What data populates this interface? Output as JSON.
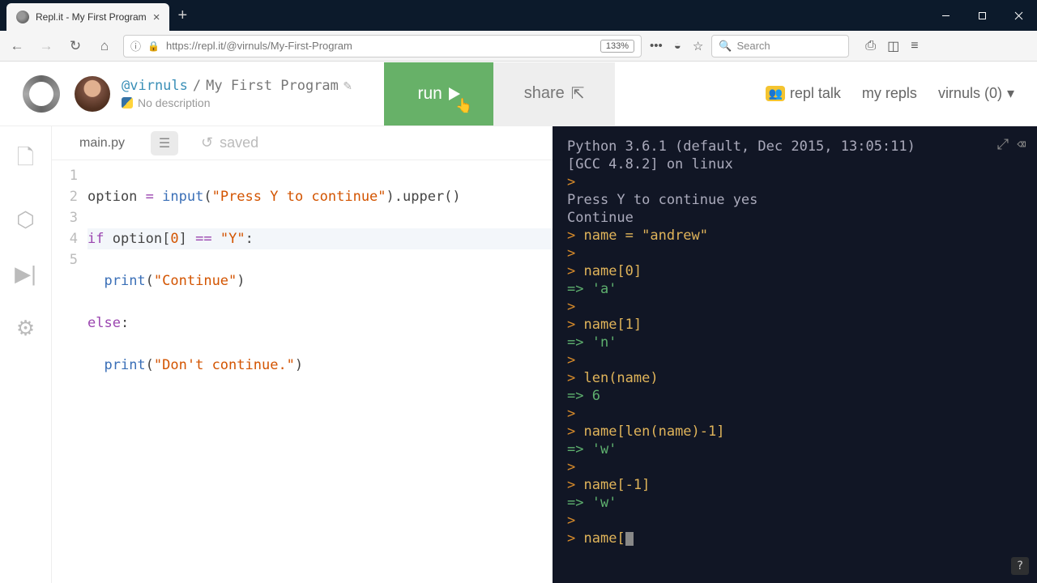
{
  "browser": {
    "tab_title": "Repl.it - My First Program",
    "url": "https://repl.it/@virnuls/My-First-Program",
    "zoom": "133%",
    "search_placeholder": "Search"
  },
  "header": {
    "user": "@virnuls",
    "separator": "/",
    "project": "My First Program",
    "description": "No description",
    "run_label": "run",
    "share_label": "share",
    "repl_talk": "repl talk",
    "my_repls": "my repls",
    "user_menu": "virnuls (0)"
  },
  "editor": {
    "filename": "main.py",
    "saved_label": "saved",
    "lines": [
      {
        "n": 1,
        "text_raw": "option = input(\"Press Y to continue\").upper()"
      },
      {
        "n": 2,
        "text_raw": "if option[0] == \"Y\":"
      },
      {
        "n": 3,
        "text_raw": "  print(\"Continue\")"
      },
      {
        "n": 4,
        "text_raw": "else:"
      },
      {
        "n": 5,
        "text_raw": "  print(\"Don't continue.\")"
      }
    ]
  },
  "terminal": {
    "info1": "Python 3.6.1 (default, Dec 2015, 13:05:11)",
    "info2": "[GCC 4.8.2] on linux",
    "io": "Press Y to continue yes",
    "out1": "Continue",
    "entries": [
      {
        "in": "name = \"andrew\"",
        "out": null
      },
      {
        "in": "",
        "out": null
      },
      {
        "in": "name[0]",
        "out": null
      },
      {
        "in": "",
        "out": "'a'"
      },
      {
        "in": "name[1]",
        "out": null
      },
      {
        "in": "",
        "out": "'n'"
      },
      {
        "in": "len(name)",
        "out": null
      },
      {
        "in": "",
        "out": "6"
      },
      {
        "in": "name[len(name)-1]",
        "out": null
      },
      {
        "in": "",
        "out": "'w'"
      },
      {
        "in": "name[-1]",
        "out": null
      },
      {
        "in": "",
        "out": "'w'"
      }
    ],
    "current": "name["
  },
  "help": "?"
}
